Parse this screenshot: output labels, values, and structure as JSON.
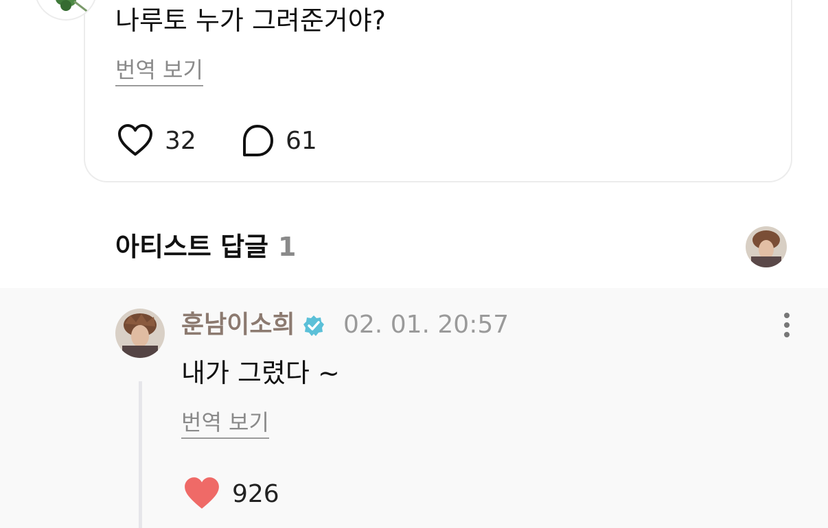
{
  "post": {
    "text": "나루토 누가 그려준거야?",
    "translate_label": "번역 보기",
    "like_count": "32",
    "comment_count": "61"
  },
  "section": {
    "title": "아티스트 답글",
    "count": "1"
  },
  "reply": {
    "author": "훈남이소희",
    "timestamp": "02. 01. 20:57",
    "text": "내가 그렸다 ~",
    "translate_label": "번역 보기",
    "like_count": "926"
  },
  "colors": {
    "verified": "#5bc0d8",
    "heart_filled": "#ef6a67",
    "author": "#8c7a70"
  },
  "icons": [
    "clover-icon",
    "heart-outline-icon",
    "comment-bubble-icon",
    "verified-badge-icon",
    "more-vertical-icon",
    "heart-filled-icon"
  ]
}
